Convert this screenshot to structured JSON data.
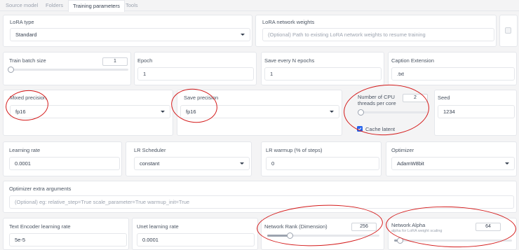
{
  "tabs": [
    {
      "label": "Source model"
    },
    {
      "label": "Folders"
    },
    {
      "label": "Training parameters",
      "active": true
    },
    {
      "label": "Tools"
    }
  ],
  "lora_type": {
    "label": "LoRA type",
    "value": "Standard"
  },
  "network_weights": {
    "label": "LoRA network weights",
    "placeholder": "(Optional) Path to existing LoRA network weights to resume training"
  },
  "train_batch_size": {
    "label": "Train batch size",
    "value": "1",
    "slider_fraction": 0.0
  },
  "epoch": {
    "label": "Epoch",
    "value": "1"
  },
  "save_every_n_epochs": {
    "label": "Save every N epochs",
    "value": "1"
  },
  "caption_extension": {
    "label": "Caption Extension",
    "value": ".txt"
  },
  "mixed_precision": {
    "label": "Mixed precision",
    "value": "fp16"
  },
  "save_precision": {
    "label": "Save precision",
    "value": "fp16"
  },
  "cpu_threads": {
    "label": "Number of CPU threads per core",
    "value": "2",
    "slider_fraction": 0.0
  },
  "seed": {
    "label": "Seed",
    "value": "1234"
  },
  "cache_latent": {
    "label": "Cache latent",
    "checked": true
  },
  "learning_rate": {
    "label": "Learning rate",
    "value": "0.0001"
  },
  "lr_scheduler": {
    "label": "LR Scheduler",
    "value": "constant"
  },
  "lr_warmup": {
    "label": "LR warmup (% of steps)",
    "value": "0"
  },
  "optimizer": {
    "label": "Optimizer",
    "value": "AdamW8bit"
  },
  "optimizer_extra_args": {
    "label": "Optimizer extra arguments",
    "placeholder": "(Optional) eg: relative_step=True scale_parameter=True warmup_init=True"
  },
  "text_encoder_lr": {
    "label": "Text Encoder learning rate",
    "value": "5e-5"
  },
  "unet_lr": {
    "label": "Unet learning rate",
    "value": "0.0001"
  },
  "network_rank": {
    "label": "Network Rank (Dimension)",
    "value": "256",
    "slider_fraction": 0.2
  },
  "network_alpha": {
    "label": "Network Alpha",
    "sublabel": "alpha for LoRA weight scaling",
    "value": "64",
    "slider_fraction": 0.05
  },
  "colors": {
    "accent": "#2563eb",
    "annotation": "#d41a1a",
    "border": "#e5e7eb"
  }
}
